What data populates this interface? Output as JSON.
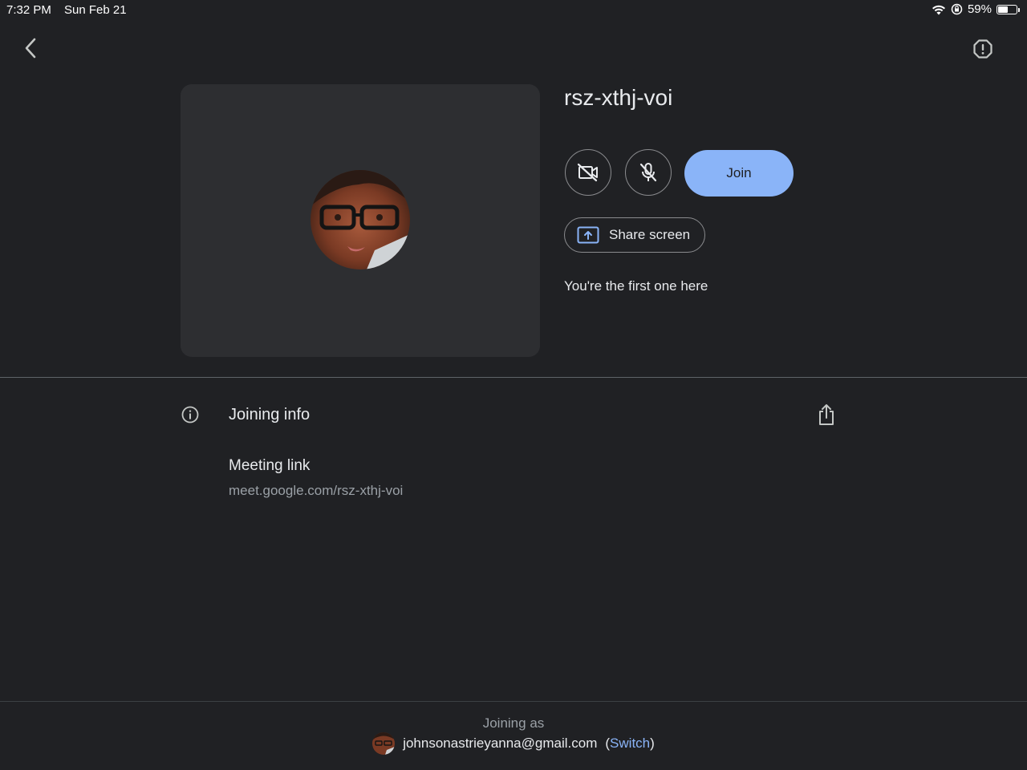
{
  "status_bar": {
    "time": "7:32 PM",
    "date": "Sun Feb 21",
    "battery_percent": "59%",
    "battery_level": 0.59,
    "icons": [
      "wifi-icon",
      "orientation-lock-icon",
      "battery-icon"
    ]
  },
  "nav": {
    "back_icon": "chevron-left-icon",
    "report_icon": "report-problem-icon"
  },
  "meeting": {
    "code": "rsz-xthj-voi",
    "join_label": "Join",
    "share_screen_label": "Share screen",
    "status_message": "You're the first one here"
  },
  "joining_info": {
    "title": "Joining info",
    "meeting_link_label": "Meeting link",
    "meeting_link_url": "meet.google.com/rsz-xthj-voi"
  },
  "account": {
    "joining_as_label": "Joining as",
    "email": "johnsonastrieyanna@gmail.com",
    "open_paren": "(",
    "switch_label": "Switch",
    "close_paren": ")"
  },
  "colors": {
    "background": "#202124",
    "preview_bg": "#2d2e31",
    "accent": "#8ab4f8",
    "secondary_text": "#9aa0a6"
  }
}
